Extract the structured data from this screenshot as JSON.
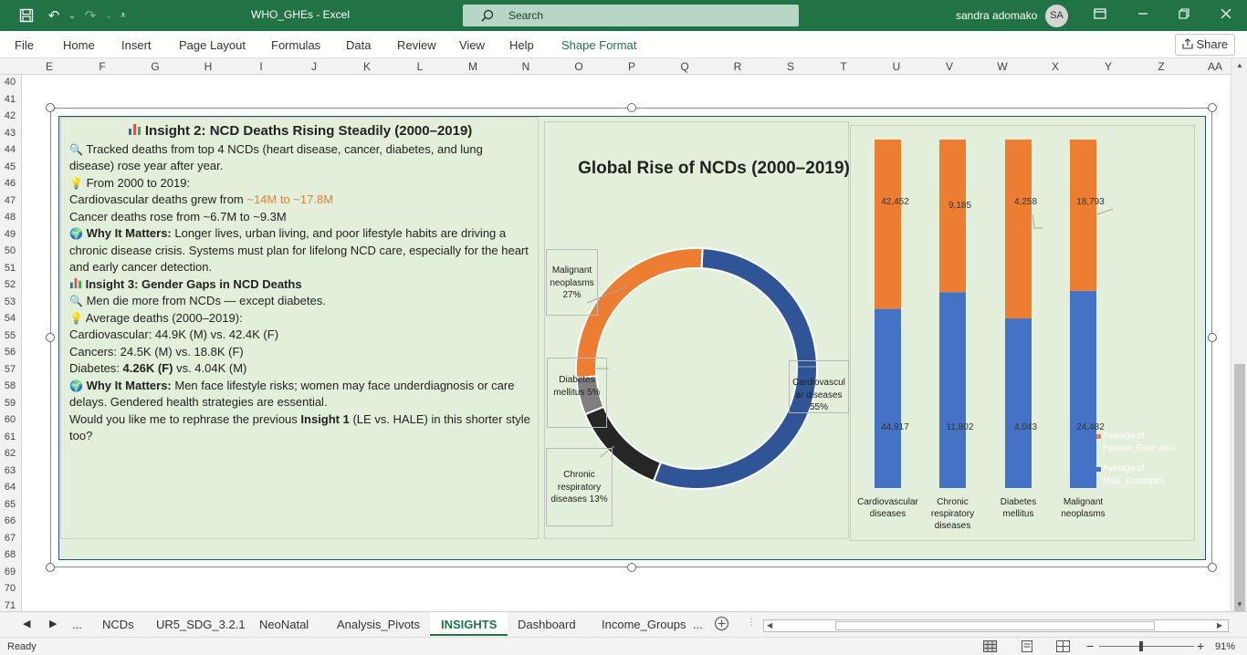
{
  "window": {
    "title": "WHO_GHEs  -  Excel",
    "search_placeholder": "Search",
    "user_name": "sandra adomako",
    "user_initials": "SA"
  },
  "ribbon": {
    "tabs": [
      "File",
      "Home",
      "Insert",
      "Page Layout",
      "Formulas",
      "Data",
      "Review",
      "View",
      "Help",
      "Shape Format"
    ],
    "share_label": "Share"
  },
  "columns": [
    "E",
    "F",
    "G",
    "H",
    "I",
    "J",
    "K",
    "L",
    "M",
    "N",
    "O",
    "P",
    "Q",
    "R",
    "S",
    "T",
    "U",
    "V",
    "W",
    "X",
    "Y",
    "Z",
    "AA"
  ],
  "rows": [
    "40",
    "41",
    "42",
    "43",
    "44",
    "45",
    "46",
    "47",
    "48",
    "49",
    "50",
    "51",
    "52",
    "53",
    "54",
    "55",
    "56",
    "57",
    "58",
    "59",
    "60",
    "61",
    "62",
    "63",
    "64",
    "65",
    "66",
    "67",
    "68",
    "69",
    "70",
    "71",
    "72"
  ],
  "textbox": {
    "h1": "Insight 2: NCD Deaths Rising Steadily (2000–2019)",
    "p1": "Tracked deaths from top 4 NCDs (heart disease, cancer, diabetes, and lung disease) rose year after year.",
    "p2": "From 2000 to 2019:",
    "p3a": "Cardiovascular deaths grew from ",
    "p3b": "~14M to ~17.8M",
    "p4": "Cancer deaths rose from ~6.7M to ~9.3M",
    "p5a": "Why It Matters:",
    "p5b": " Longer lives, urban living, and poor lifestyle habits are driving a chronic disease crisis. Systems must plan for lifelong NCD care, especially for the heart and early cancer detection.",
    "h2": "Insight 3: Gender Gaps in NCD Deaths",
    "p6": "Men die more from NCDs — except diabetes.",
    "p7": "Average deaths (2000–2019):",
    "p8": "Cardiovascular: 44.9K (M) vs. 42.4K (F)",
    "p9": "Cancers: 24.5K (M) vs. 18.8K (F)",
    "p10a": "Diabetes: ",
    "p10b": "4.26K (F)",
    "p10c": " vs. 4.04K (M)",
    "p11a": "Why It Matters:",
    "p11b": " Men face lifestyle risks; women may face underdiagnosis or care delays. Gendered health strategies are essential.",
    "p12a": "Would you like me to rephrase the previous ",
    "p12b": "Insight 1",
    "p12c": " (LE vs. HALE) in this shorter style too?"
  },
  "chart_data": [
    {
      "type": "pie",
      "title": "Global Rise of NCDs (2000–2019)",
      "categories": [
        "Cardiovascular diseases",
        "Chronic respiratory diseases",
        "Diabetes mellitus",
        "Malignant neoplasms"
      ],
      "values": [
        55,
        13,
        5,
        27
      ],
      "data_labels": [
        "Cardiovascul ar diseases 55%",
        "Chronic respiratory diseases 13%",
        "Diabetes mellitus 5%",
        "Malignant neoplasms 27%"
      ]
    },
    {
      "type": "bar",
      "stacked": true,
      "categories": [
        "Cardiovascular diseases",
        "Chronic respiratory diseases",
        "Diabetes mellitus",
        "Malignant neoplasms"
      ],
      "series": [
        {
          "name": "Average of Male_Estimates",
          "values": [
            44917,
            11802,
            4043,
            24482
          ],
          "labels": [
            "44,917",
            "11,802",
            "4,043",
            "24,482"
          ],
          "color": "#4472c4"
        },
        {
          "name": "Average of Female_Estimates",
          "values": [
            42452,
            9185,
            4258,
            18793
          ],
          "labels": [
            "42,452",
            "9,185",
            "4,258",
            "18,793"
          ],
          "color": "#ed7d31"
        }
      ],
      "legend": "right"
    }
  ],
  "colors": {
    "donut": [
      "#2f5597",
      "#262626",
      "#7f7f7f",
      "#ed7d31"
    ]
  },
  "sheet_tabs": {
    "items": [
      "...",
      "NCDs",
      "UR5_SDG_3.2.1",
      "NeoNatal",
      "Analysis_Pivots",
      "INSIGHTS",
      "Dashboard",
      "Income_Groups",
      "..."
    ],
    "active": "INSIGHTS"
  },
  "status": {
    "ready": "Ready",
    "zoom": "91%",
    "minus": "−",
    "plus": "+"
  }
}
